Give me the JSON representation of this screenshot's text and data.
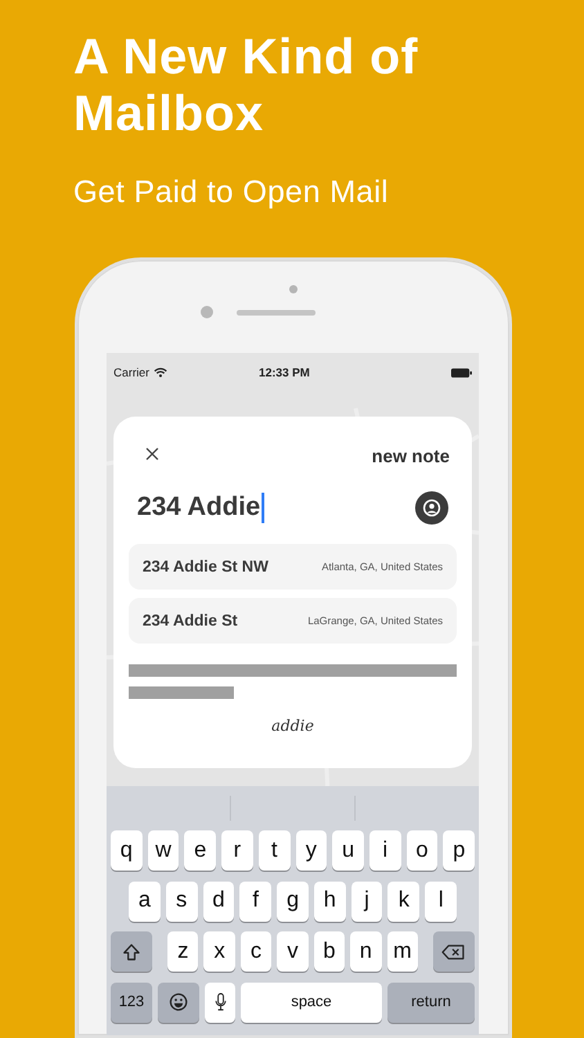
{
  "headline": "A New Kind of Mailbox",
  "tagline": "Get Paid to Open Mail",
  "status_bar": {
    "carrier": "Carrier",
    "time": "12:33 PM"
  },
  "note_card": {
    "title": "new note",
    "address_input": {
      "value": "234 Addie",
      "focused": true
    },
    "suggestions": [
      {
        "street": "234 Addie St NW",
        "place": "Atlanta, GA, United States"
      },
      {
        "street": "234 Addie St",
        "place": "LaGrange, GA, United States"
      }
    ],
    "brand": "addie"
  },
  "keyboard": {
    "rows": [
      {
        "keys": [
          {
            "kind": "letter",
            "label": "q"
          },
          {
            "kind": "letter",
            "label": "w"
          },
          {
            "kind": "letter",
            "label": "e"
          },
          {
            "kind": "letter",
            "label": "r"
          },
          {
            "kind": "letter",
            "label": "t"
          },
          {
            "kind": "letter",
            "label": "y"
          },
          {
            "kind": "letter",
            "label": "u"
          },
          {
            "kind": "letter",
            "label": "i"
          },
          {
            "kind": "letter",
            "label": "o"
          },
          {
            "kind": "letter",
            "label": "p"
          }
        ]
      },
      {
        "keys": [
          {
            "kind": "letter",
            "label": "a"
          },
          {
            "kind": "letter",
            "label": "s"
          },
          {
            "kind": "letter",
            "label": "d"
          },
          {
            "kind": "letter",
            "label": "f"
          },
          {
            "kind": "letter",
            "label": "g"
          },
          {
            "kind": "letter",
            "label": "h"
          },
          {
            "kind": "letter",
            "label": "j"
          },
          {
            "kind": "letter",
            "label": "k"
          },
          {
            "kind": "letter",
            "label": "l"
          }
        ]
      },
      {
        "keys": [
          {
            "kind": "shift"
          },
          {
            "kind": "letter",
            "label": "z"
          },
          {
            "kind": "letter",
            "label": "x"
          },
          {
            "kind": "letter",
            "label": "c"
          },
          {
            "kind": "letter",
            "label": "v"
          },
          {
            "kind": "letter",
            "label": "b"
          },
          {
            "kind": "letter",
            "label": "n"
          },
          {
            "kind": "letter",
            "label": "m"
          },
          {
            "kind": "delete"
          }
        ]
      },
      {
        "keys": [
          {
            "kind": "numbers",
            "label": "123"
          },
          {
            "kind": "emoji"
          },
          {
            "kind": "mic"
          },
          {
            "kind": "space",
            "label": "space"
          },
          {
            "kind": "return",
            "label": "return"
          }
        ]
      }
    ]
  }
}
